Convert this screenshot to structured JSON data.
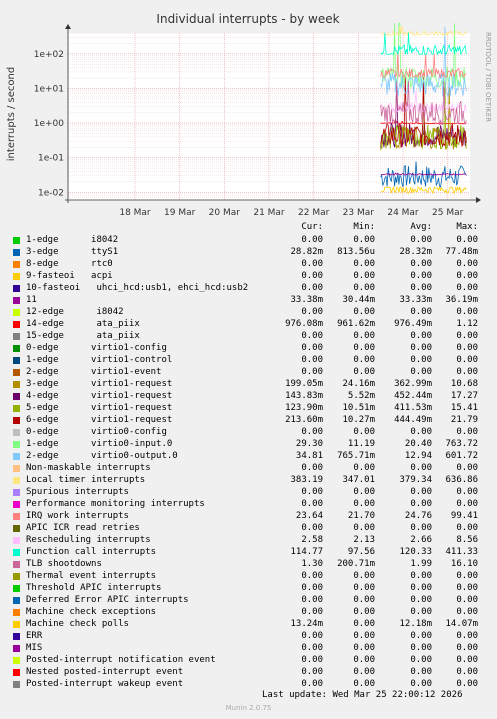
{
  "chart_data": {
    "type": "line",
    "title": "Individual interrupts - by week",
    "ylabel": "interrupts / second",
    "yscale": "log",
    "ylim": [
      0.006,
      400
    ],
    "yticks": [
      {
        "value": 0.01,
        "label": "1e-02"
      },
      {
        "value": 0.1,
        "label": "1e-01"
      },
      {
        "value": 1,
        "label": "1e+00"
      },
      {
        "value": 10,
        "label": "1e+01"
      },
      {
        "value": 100,
        "label": "1e+02"
      }
    ],
    "xticks": [
      "18 Mar",
      "19 Mar",
      "20 Mar",
      "21 Mar",
      "22 Mar",
      "23 Mar",
      "24 Mar",
      "25 Mar"
    ],
    "xrange": [
      "2026-03-17",
      "2026-03-26"
    ],
    "data_start": "2026-03-24",
    "grid": true,
    "watermark": "RRDTOOL / TOBI OETIKER",
    "columns": [
      "Cur:",
      "Min:",
      "Avg:",
      "Max:"
    ],
    "series": [
      {
        "name": "1-edge      i8042",
        "color": "#00cc00",
        "cur": "0.00",
        "min": "0.00",
        "avg": "0.00",
        "max": "0.00"
      },
      {
        "name": "3-edge      ttyS1",
        "color": "#0066b3",
        "cur": "28.82m",
        "min": "813.56u",
        "avg": "28.32m",
        "max": "77.48m"
      },
      {
        "name": "8-edge      rtc0",
        "color": "#ff8000",
        "cur": "0.00",
        "min": "0.00",
        "avg": "0.00",
        "max": "0.00"
      },
      {
        "name": "9-fasteoi   acpi",
        "color": "#ffcc00",
        "cur": "0.00",
        "min": "0.00",
        "avg": "0.00",
        "max": "0.00"
      },
      {
        "name": "10-fasteoi   uhci_hcd:usb1, ehci_hcd:usb2",
        "color": "#330099",
        "cur": "0.00",
        "min": "0.00",
        "avg": "0.00",
        "max": "0.00"
      },
      {
        "name": "11",
        "color": "#990099",
        "cur": "33.38m",
        "min": "30.44m",
        "avg": "33.33m",
        "max": "36.19m"
      },
      {
        "name": "12-edge      i8042",
        "color": "#ccff00",
        "cur": "0.00",
        "min": "0.00",
        "avg": "0.00",
        "max": "0.00"
      },
      {
        "name": "14-edge      ata_piix",
        "color": "#ff0000",
        "cur": "976.08m",
        "min": "961.62m",
        "avg": "976.49m",
        "max": "1.12"
      },
      {
        "name": "15-edge      ata_piix",
        "color": "#808080",
        "cur": "0.00",
        "min": "0.00",
        "avg": "0.00",
        "max": "0.00"
      },
      {
        "name": "0-edge      virtio1-config",
        "color": "#008f00",
        "cur": "0.00",
        "min": "0.00",
        "avg": "0.00",
        "max": "0.00"
      },
      {
        "name": "1-edge      virtio1-control",
        "color": "#00487d",
        "cur": "0.00",
        "min": "0.00",
        "avg": "0.00",
        "max": "0.00"
      },
      {
        "name": "2-edge      virtio1-event",
        "color": "#b35a00",
        "cur": "0.00",
        "min": "0.00",
        "avg": "0.00",
        "max": "0.00"
      },
      {
        "name": "3-edge      virtio1-request",
        "color": "#b38f00",
        "cur": "199.05m",
        "min": "24.16m",
        "avg": "362.99m",
        "max": "10.68"
      },
      {
        "name": "4-edge      virtio1-request",
        "color": "#6b006b",
        "cur": "143.83m",
        "min": "5.52m",
        "avg": "452.44m",
        "max": "17.27"
      },
      {
        "name": "5-edge      virtio1-request",
        "color": "#8fb300",
        "cur": "123.90m",
        "min": "10.51m",
        "avg": "411.53m",
        "max": "15.41"
      },
      {
        "name": "6-edge      virtio1-request",
        "color": "#b30000",
        "cur": "213.60m",
        "min": "10.27m",
        "avg": "444.49m",
        "max": "21.79"
      },
      {
        "name": "0-edge      virtio0-config",
        "color": "#bebebe",
        "cur": "0.00",
        "min": "0.00",
        "avg": "0.00",
        "max": "0.00"
      },
      {
        "name": "1-edge      virtio0-input.0",
        "color": "#80ff80",
        "cur": "29.30",
        "min": "11.19",
        "avg": "20.40",
        "max": "763.72"
      },
      {
        "name": "2-edge      virtio0-output.0",
        "color": "#80c9ff",
        "cur": "34.81",
        "min": "765.71m",
        "avg": "12.94",
        "max": "601.72"
      },
      {
        "name": "Non-maskable interrupts",
        "color": "#ffc080",
        "cur": "0.00",
        "min": "0.00",
        "avg": "0.00",
        "max": "0.00"
      },
      {
        "name": "Local timer interrupts",
        "color": "#ffe680",
        "cur": "383.19",
        "min": "347.01",
        "avg": "379.34",
        "max": "636.86"
      },
      {
        "name": "Spurious interrupts",
        "color": "#aa80ff",
        "cur": "0.00",
        "min": "0.00",
        "avg": "0.00",
        "max": "0.00"
      },
      {
        "name": "Performance monitoring interrupts",
        "color": "#ee00cc",
        "cur": "0.00",
        "min": "0.00",
        "avg": "0.00",
        "max": "0.00"
      },
      {
        "name": "IRQ work interrupts",
        "color": "#ff8080",
        "cur": "23.64",
        "min": "21.70",
        "avg": "24.76",
        "max": "99.41"
      },
      {
        "name": "APIC ICR read retries",
        "color": "#666600",
        "cur": "0.00",
        "min": "0.00",
        "avg": "0.00",
        "max": "0.00"
      },
      {
        "name": "Rescheduling interrupts",
        "color": "#ffbfff",
        "cur": "2.58",
        "min": "2.13",
        "avg": "2.66",
        "max": "8.56"
      },
      {
        "name": "Function call interrupts",
        "color": "#00ffcc",
        "cur": "114.77",
        "min": "97.56",
        "avg": "120.33",
        "max": "411.33"
      },
      {
        "name": "TLB shootdowns",
        "color": "#cc6699",
        "cur": "1.30",
        "min": "200.71m",
        "avg": "1.99",
        "max": "16.10"
      },
      {
        "name": "Thermal event interrupts",
        "color": "#999900",
        "cur": "0.00",
        "min": "0.00",
        "avg": "0.00",
        "max": "0.00"
      },
      {
        "name": "Threshold APIC interrupts",
        "color": "#00cc00",
        "cur": "0.00",
        "min": "0.00",
        "avg": "0.00",
        "max": "0.00"
      },
      {
        "name": "Deferred Error APIC interrupts",
        "color": "#0066b3",
        "cur": "0.00",
        "min": "0.00",
        "avg": "0.00",
        "max": "0.00"
      },
      {
        "name": "Machine check exceptions",
        "color": "#ff8000",
        "cur": "0.00",
        "min": "0.00",
        "avg": "0.00",
        "max": "0.00"
      },
      {
        "name": "Machine check polls",
        "color": "#ffcc00",
        "cur": "13.24m",
        "min": "0.00",
        "avg": "12.18m",
        "max": "14.07m"
      },
      {
        "name": "ERR",
        "color": "#330099",
        "cur": "0.00",
        "min": "0.00",
        "avg": "0.00",
        "max": "0.00"
      },
      {
        "name": "MIS",
        "color": "#990099",
        "cur": "0.00",
        "min": "0.00",
        "avg": "0.00",
        "max": "0.00"
      },
      {
        "name": "Posted-interrupt notification event",
        "color": "#ccff00",
        "cur": "0.00",
        "min": "0.00",
        "avg": "0.00",
        "max": "0.00"
      },
      {
        "name": "Nested posted-interrupt event",
        "color": "#ff0000",
        "cur": "0.00",
        "min": "0.00",
        "avg": "0.00",
        "max": "0.00"
      },
      {
        "name": "Posted-interrupt wakeup event",
        "color": "#808080",
        "cur": "0.00",
        "min": "0.00",
        "avg": "0.00",
        "max": "0.00"
      }
    ]
  },
  "footer": {
    "last_update": "Last update: Wed Mar 25 22:00:12 2026",
    "version": "Munin 2.0.75"
  }
}
